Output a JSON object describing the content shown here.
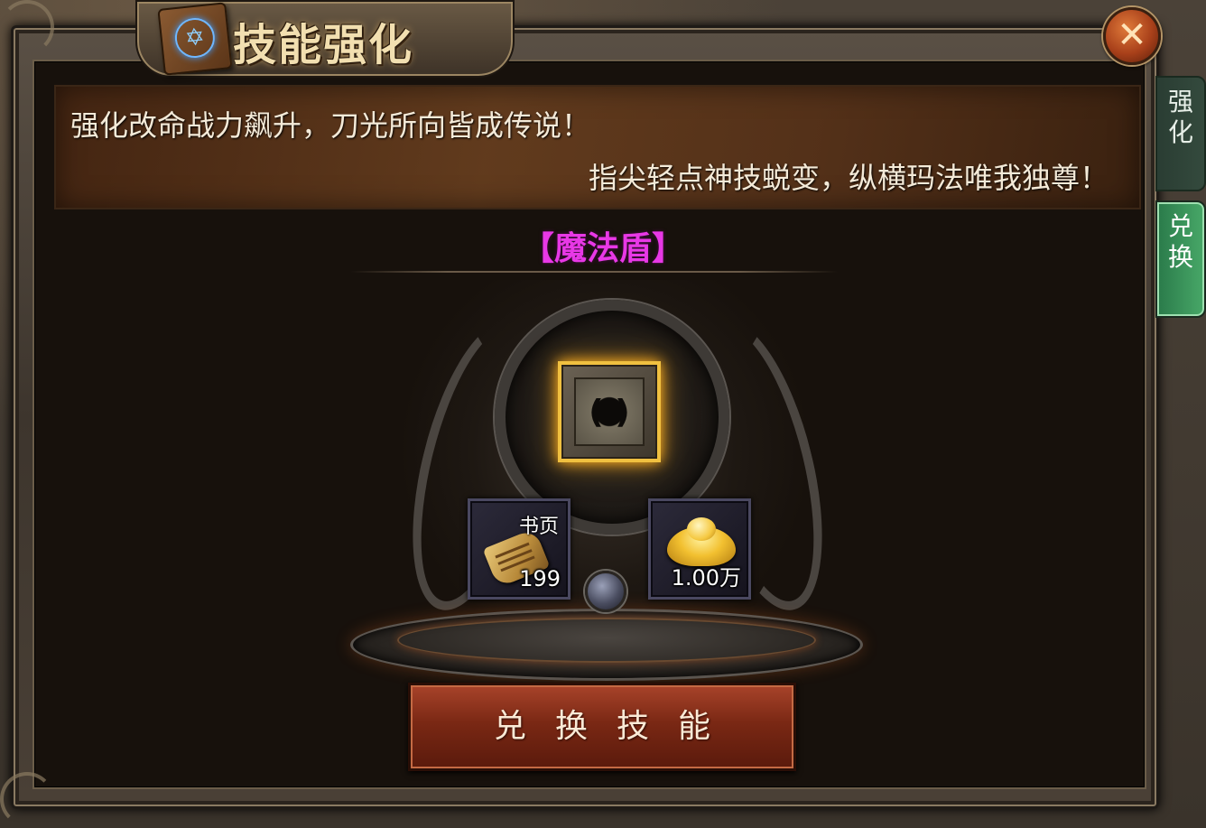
{
  "window": {
    "title": "技能强化",
    "close_label": "✕"
  },
  "tabs": [
    {
      "label": "强\n化",
      "selected": false
    },
    {
      "label": "兑\n换",
      "selected": true
    }
  ],
  "banner": {
    "line1": "强化改命战力飙升，刀光所向皆成传说！",
    "line2": "指尖轻点神技蜕变，纵横玛法唯我独尊！"
  },
  "skill": {
    "name": "【魔法盾】",
    "icon": "magic-shield-skill-icon"
  },
  "costs": [
    {
      "label": "书页",
      "count": "199",
      "icon": "scroll-page-icon"
    },
    {
      "label": "",
      "count": "1.00万",
      "icon": "gold-ingot-icon"
    }
  ],
  "action": {
    "label": "兑换技能"
  },
  "colors": {
    "skill_name": "#e838e6",
    "button": "#7a2814",
    "active_tab": "#48a868",
    "slot_glow": "#f0c040"
  }
}
